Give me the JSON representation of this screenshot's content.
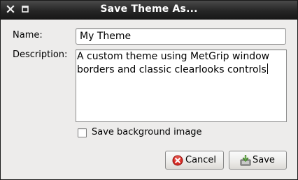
{
  "window": {
    "title": "Save Theme As..."
  },
  "titlebar_icons": {
    "close": "close-icon",
    "maximize": "maximize-icon"
  },
  "form": {
    "name_label": "Name:",
    "name_value": "My Theme",
    "description_label": "Description:",
    "description_lines": [
      "A custom theme using MetGrip window",
      "borders and classic clearlooks controls"
    ],
    "save_background_label": "Save background image",
    "save_background_checked": false
  },
  "buttons": {
    "cancel_label": "Cancel",
    "cancel_icon": "cancel-icon",
    "save_label": "Save",
    "save_icon": "save-icon"
  },
  "colors": {
    "titlebar": "#262626",
    "dialog_background": "#edeceb",
    "cancel_icon": "#d62a24",
    "save_icon": "#6aa84f"
  }
}
